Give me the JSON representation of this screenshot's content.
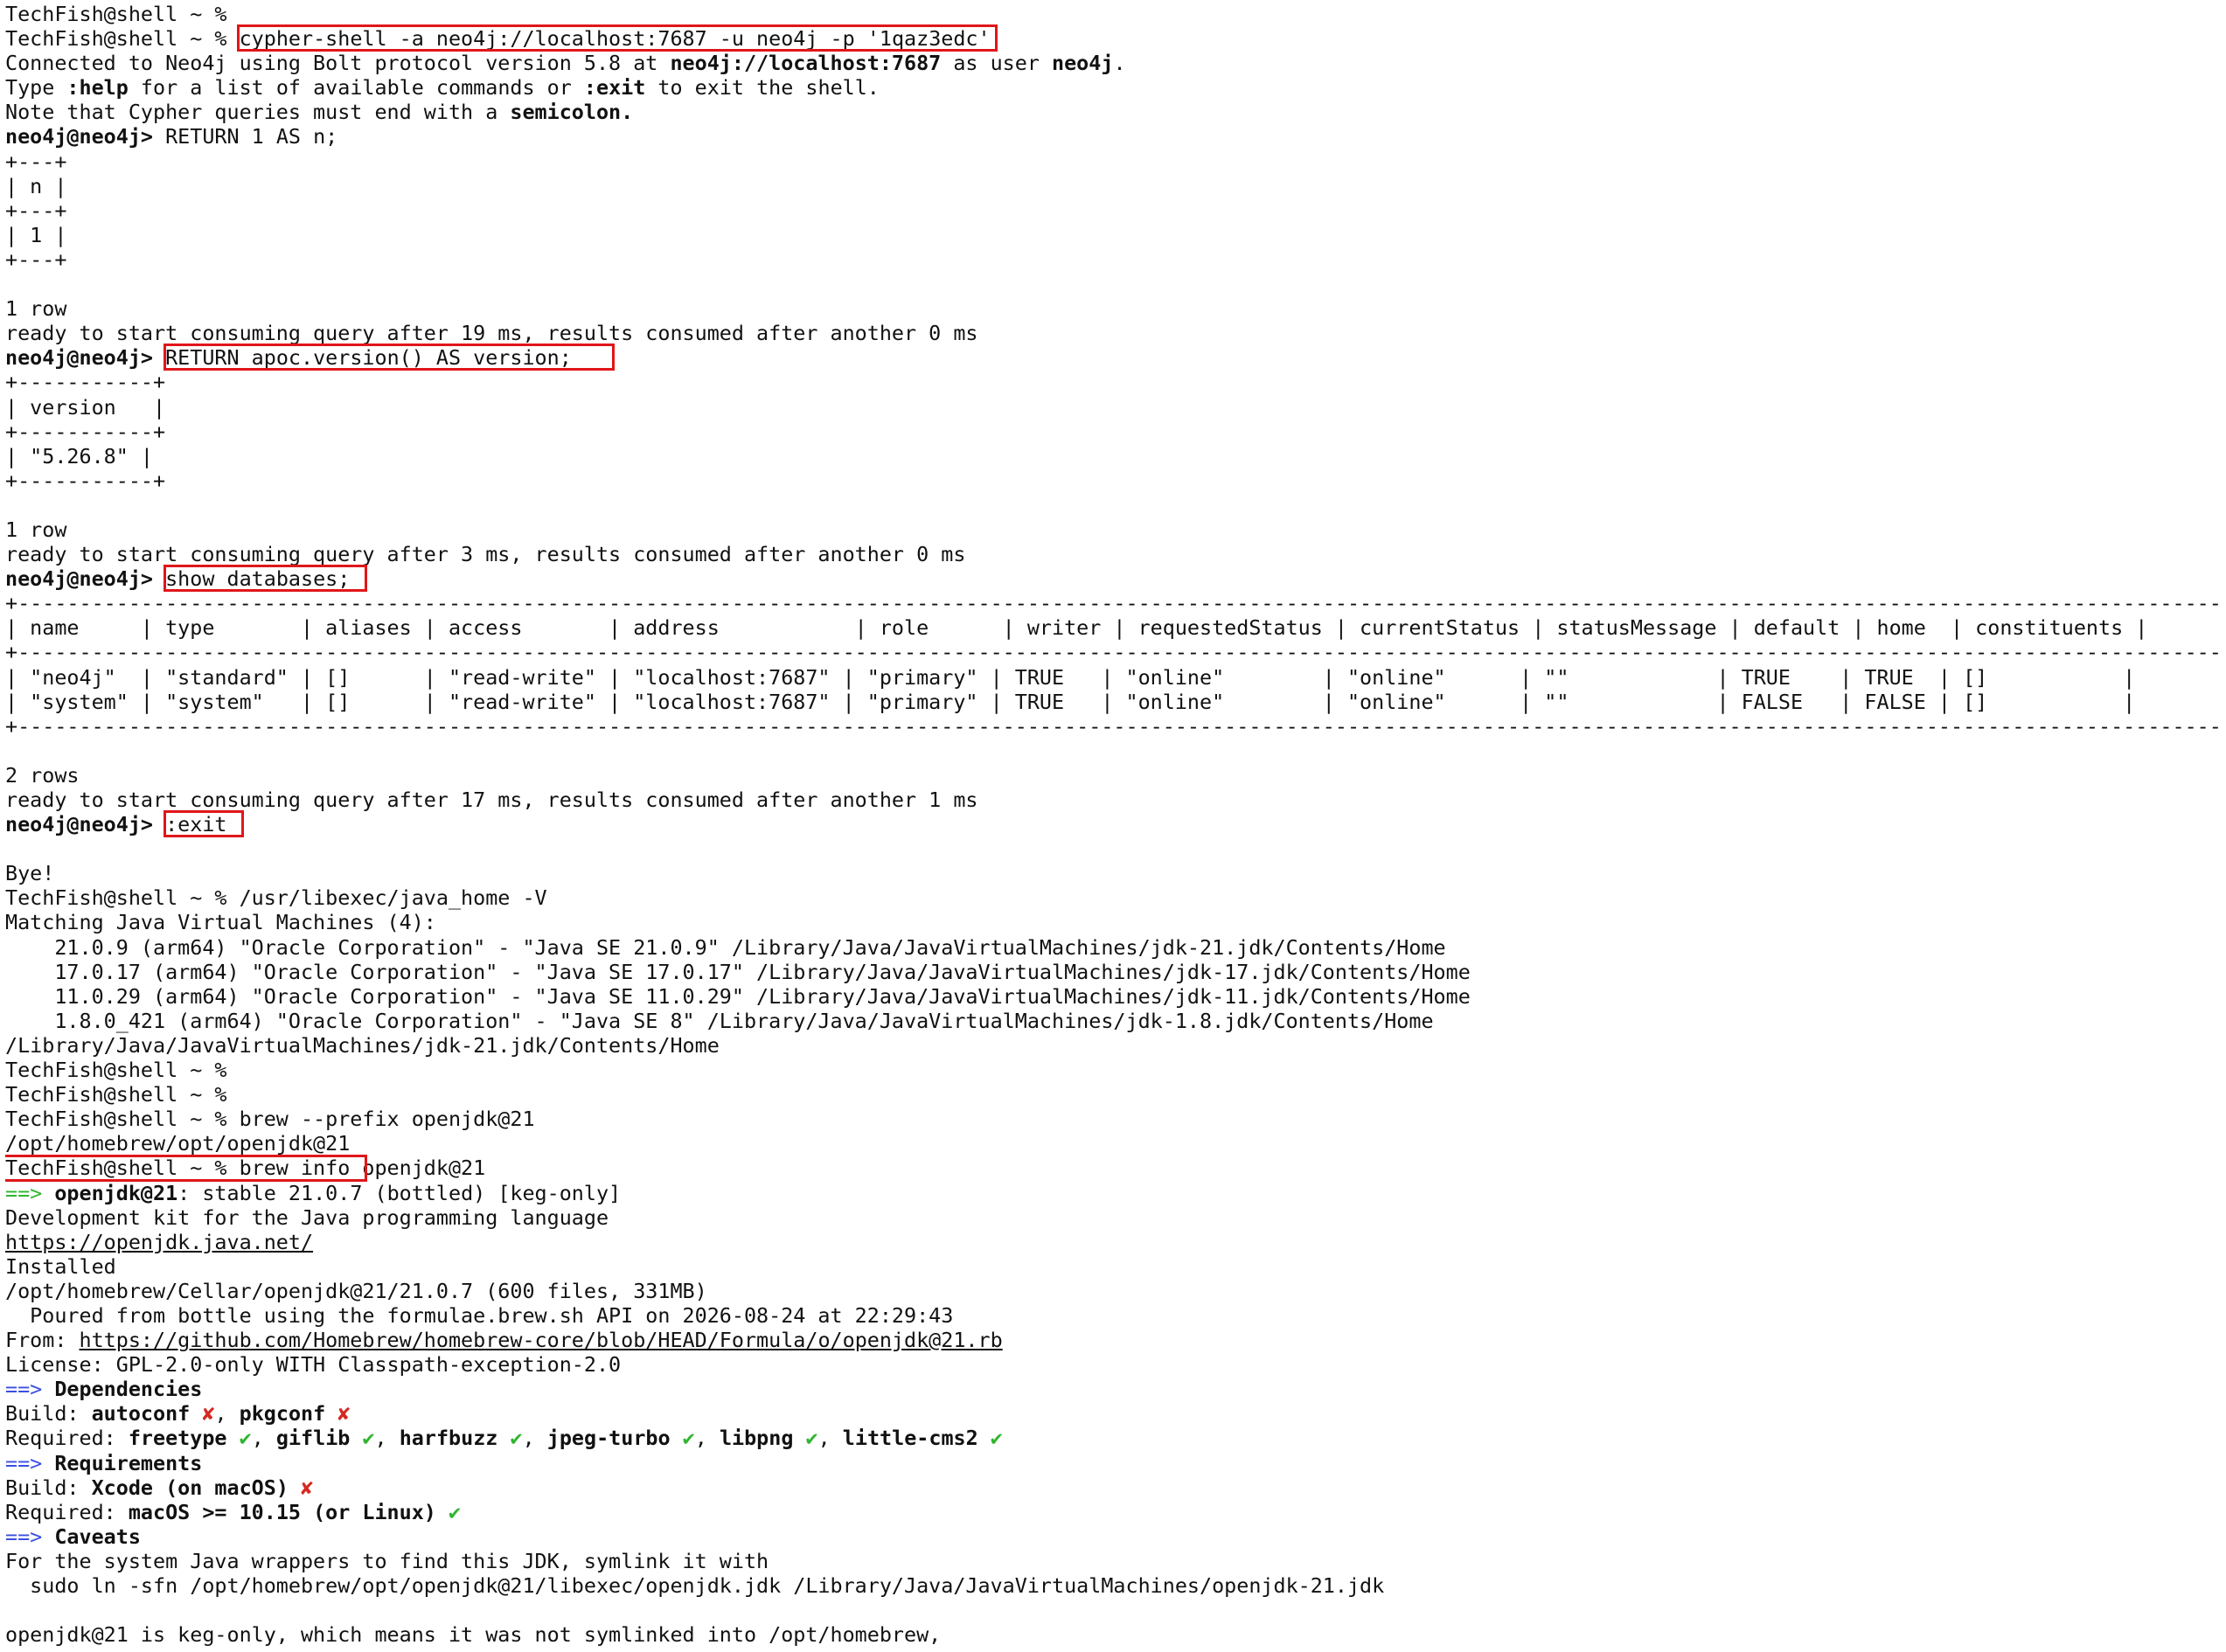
{
  "terminal": {
    "lines": [
      [
        {
          "t": "TechFish@shell ~ %"
        }
      ],
      [
        {
          "t": "TechFish@shell ~ % "
        },
        {
          "t": "cypher-shell -a neo4j://localhost:7687 -u neo4j -p '1qaz3edc'"
        }
      ],
      [
        {
          "t": "Connected to Neo4j using Bolt protocol version 5.8 at "
        },
        {
          "t": "neo4j://localhost:7687",
          "b": true
        },
        {
          "t": " as user "
        },
        {
          "t": "neo4j",
          "b": true
        },
        {
          "t": "."
        }
      ],
      [
        {
          "t": "Type "
        },
        {
          "t": ":help",
          "b": true
        },
        {
          "t": " for a list of available commands or "
        },
        {
          "t": ":exit",
          "b": true
        },
        {
          "t": " to exit the shell."
        }
      ],
      [
        {
          "t": "Note that Cypher queries must end with a "
        },
        {
          "t": "semicolon.",
          "b": true
        }
      ],
      [
        {
          "t": "neo4j@neo4j>",
          "b": true
        },
        {
          "t": " RETURN 1 AS n;"
        }
      ],
      [
        {
          "t": "+---+"
        }
      ],
      [
        {
          "t": "| n |"
        }
      ],
      [
        {
          "t": "+---+"
        }
      ],
      [
        {
          "t": "| 1 |"
        }
      ],
      [
        {
          "t": "+---+"
        }
      ],
      [
        {
          "t": ""
        }
      ],
      [
        {
          "t": "1 row"
        }
      ],
      [
        {
          "t": "ready to start consuming query after 19 ms, results consumed after another 0 ms"
        }
      ],
      [
        {
          "t": "neo4j@neo4j>",
          "b": true
        },
        {
          "t": " RETURN apoc.version() AS version;"
        }
      ],
      [
        {
          "t": "+-----------+"
        }
      ],
      [
        {
          "t": "| version   |"
        }
      ],
      [
        {
          "t": "+-----------+"
        }
      ],
      [
        {
          "t": "| \"5.26.8\" |"
        }
      ],
      [
        {
          "t": "+-----------+"
        }
      ],
      [
        {
          "t": ""
        }
      ],
      [
        {
          "t": "1 row"
        }
      ],
      [
        {
          "t": "ready to start consuming query after 3 ms, results consumed after another 0 ms"
        }
      ],
      [
        {
          "t": "neo4j@neo4j>",
          "b": true
        },
        {
          "t": " show databases;"
        }
      ],
      [
        {
          "t": "+------------------------------------------------------------------------------------------------------------------------------------------------------------------------------------+"
        }
      ],
      [
        {
          "t": "| name     | type       | aliases | access       | address           | role      | writer | requestedStatus | currentStatus | statusMessage | default | home  | constituents |"
        }
      ],
      [
        {
          "t": "+------------------------------------------------------------------------------------------------------------------------------------------------------------------------------------+"
        }
      ],
      [
        {
          "t": "| \"neo4j\"  | \"standard\" | []      | \"read-write\" | \"localhost:7687\" | \"primary\" | TRUE   | \"online\"        | \"online\"      | \"\"            | TRUE    | TRUE  | []           |"
        }
      ],
      [
        {
          "t": "| \"system\" | \"system\"   | []      | \"read-write\" | \"localhost:7687\" | \"primary\" | TRUE   | \"online\"        | \"online\"      | \"\"            | FALSE   | FALSE | []           |"
        }
      ],
      [
        {
          "t": "+------------------------------------------------------------------------------------------------------------------------------------------------------------------------------------+"
        }
      ],
      [
        {
          "t": ""
        }
      ],
      [
        {
          "t": "2 rows"
        }
      ],
      [
        {
          "t": "ready to start consuming query after 17 ms, results consumed after another 1 ms"
        }
      ],
      [
        {
          "t": "neo4j@neo4j>",
          "b": true
        },
        {
          "t": " :exit"
        }
      ],
      [
        {
          "t": ""
        }
      ],
      [
        {
          "t": "Bye!"
        }
      ],
      [
        {
          "t": "TechFish@shell ~ % /usr/libexec/java_home -V"
        }
      ],
      [
        {
          "t": "Matching Java Virtual Machines (4):"
        }
      ],
      [
        {
          "t": "    21.0.9 (arm64) \"Oracle Corporation\" - \"Java SE 21.0.9\" /Library/Java/JavaVirtualMachines/jdk-21.jdk/Contents/Home"
        }
      ],
      [
        {
          "t": "    17.0.17 (arm64) \"Oracle Corporation\" - \"Java SE 17.0.17\" /Library/Java/JavaVirtualMachines/jdk-17.jdk/Contents/Home"
        }
      ],
      [
        {
          "t": "    11.0.29 (arm64) \"Oracle Corporation\" - \"Java SE 11.0.29\" /Library/Java/JavaVirtualMachines/jdk-11.jdk/Contents/Home"
        }
      ],
      [
        {
          "t": "    1.8.0_421 (arm64) \"Oracle Corporation\" - \"Java SE 8\" /Library/Java/JavaVirtualMachines/jdk-1.8.jdk/Contents/Home"
        }
      ],
      [
        {
          "t": "/Library/Java/JavaVirtualMachines/jdk-21.jdk/Contents/Home"
        }
      ],
      [
        {
          "t": "TechFish@shell ~ %"
        }
      ],
      [
        {
          "t": "TechFish@shell ~ %"
        }
      ],
      [
        {
          "t": "TechFish@shell ~ % brew --prefix openjdk@21"
        }
      ],
      [
        {
          "t": "/opt/homebrew/opt/openjdk@21"
        }
      ],
      [
        {
          "t": "TechFish@shell ~ % brew info openjdk@21"
        }
      ],
      [
        {
          "t": "==>",
          "c": "green"
        },
        {
          "t": " "
        },
        {
          "t": "openjdk@21",
          "b": true
        },
        {
          "t": ": stable 21.0.7 (bottled) [keg-only]"
        }
      ],
      [
        {
          "t": "Development kit for the Java programming language"
        }
      ],
      [
        {
          "t": "https://openjdk.java.net/",
          "link": true
        }
      ],
      [
        {
          "t": "Installed"
        }
      ],
      [
        {
          "t": "/opt/homebrew/Cellar/openjdk@21/21.0.7 (600 files, 331MB)"
        }
      ],
      [
        {
          "t": "  Poured from bottle using the formulae.brew.sh API on 2026-08-24 at 22:29:43"
        }
      ],
      [
        {
          "t": "From: "
        },
        {
          "t": "https://github.com/Homebrew/homebrew-core/blob/HEAD/Formula/o/openjdk@21.rb",
          "link": true
        }
      ],
      [
        {
          "t": "License: GPL-2.0-only WITH Classpath-exception-2.0"
        }
      ],
      [
        {
          "t": "==>",
          "c": "blue"
        },
        {
          "t": " "
        },
        {
          "t": "Dependencies",
          "b": true
        }
      ],
      [
        {
          "t": "Build: "
        },
        {
          "t": "autoconf",
          "b": true
        },
        {
          "t": " "
        },
        {
          "t": "✘",
          "c": "red"
        },
        {
          "t": ", "
        },
        {
          "t": "pkgconf",
          "b": true
        },
        {
          "t": " "
        },
        {
          "t": "✘",
          "c": "red"
        }
      ],
      [
        {
          "t": "Required: "
        },
        {
          "t": "freetype",
          "b": true
        },
        {
          "t": " "
        },
        {
          "t": "✔",
          "c": "green"
        },
        {
          "t": ", "
        },
        {
          "t": "giflib",
          "b": true
        },
        {
          "t": " "
        },
        {
          "t": "✔",
          "c": "green"
        },
        {
          "t": ", "
        },
        {
          "t": "harfbuzz",
          "b": true
        },
        {
          "t": " "
        },
        {
          "t": "✔",
          "c": "green"
        },
        {
          "t": ", "
        },
        {
          "t": "jpeg-turbo",
          "b": true
        },
        {
          "t": " "
        },
        {
          "t": "✔",
          "c": "green"
        },
        {
          "t": ", "
        },
        {
          "t": "libpng",
          "b": true
        },
        {
          "t": " "
        },
        {
          "t": "✔",
          "c": "green"
        },
        {
          "t": ", "
        },
        {
          "t": "little-cms2",
          "b": true
        },
        {
          "t": " "
        },
        {
          "t": "✔",
          "c": "green"
        }
      ],
      [
        {
          "t": "==>",
          "c": "blue"
        },
        {
          "t": " "
        },
        {
          "t": "Requirements",
          "b": true
        }
      ],
      [
        {
          "t": "Build: "
        },
        {
          "t": "Xcode (on macOS)",
          "b": true
        },
        {
          "t": " "
        },
        {
          "t": "✘",
          "c": "red"
        }
      ],
      [
        {
          "t": "Required: "
        },
        {
          "t": "macOS >= 10.15 (or Linux)",
          "b": true
        },
        {
          "t": " "
        },
        {
          "t": "✔",
          "c": "green"
        }
      ],
      [
        {
          "t": "==>",
          "c": "blue"
        },
        {
          "t": " "
        },
        {
          "t": "Caveats",
          "b": true
        }
      ],
      [
        {
          "t": "For the system Java wrappers to find this JDK, symlink it with"
        }
      ],
      [
        {
          "t": "  sudo ln -sfn /opt/homebrew/opt/openjdk@21/libexec/openjdk.jdk /Library/Java/JavaVirtualMachines/openjdk-21.jdk"
        }
      ],
      [
        {
          "t": ""
        }
      ],
      [
        {
          "t": "openjdk@21 is keg-only, which means it was not symlinked into /opt/homebrew,"
        }
      ]
    ],
    "cursor_marks": [
      4,
      5,
      9,
      10,
      12,
      13,
      17,
      35,
      51,
      54
    ],
    "highlights": [
      {
        "line": 1,
        "start": 19,
        "end": 80
      },
      {
        "line": 14,
        "start": 13,
        "end": 49
      },
      {
        "line": 23,
        "start": 13,
        "end": 29
      },
      {
        "line": 33,
        "start": 13,
        "end": 19
      },
      {
        "line": 47,
        "start": 0,
        "end": 29
      }
    ],
    "colors": {
      "background": "#ffffff",
      "text": "#111111",
      "green": "#2fb52f",
      "blue": "#3b4fe0",
      "red": "#d42a20",
      "highlight_border": "#e0161a"
    }
  }
}
